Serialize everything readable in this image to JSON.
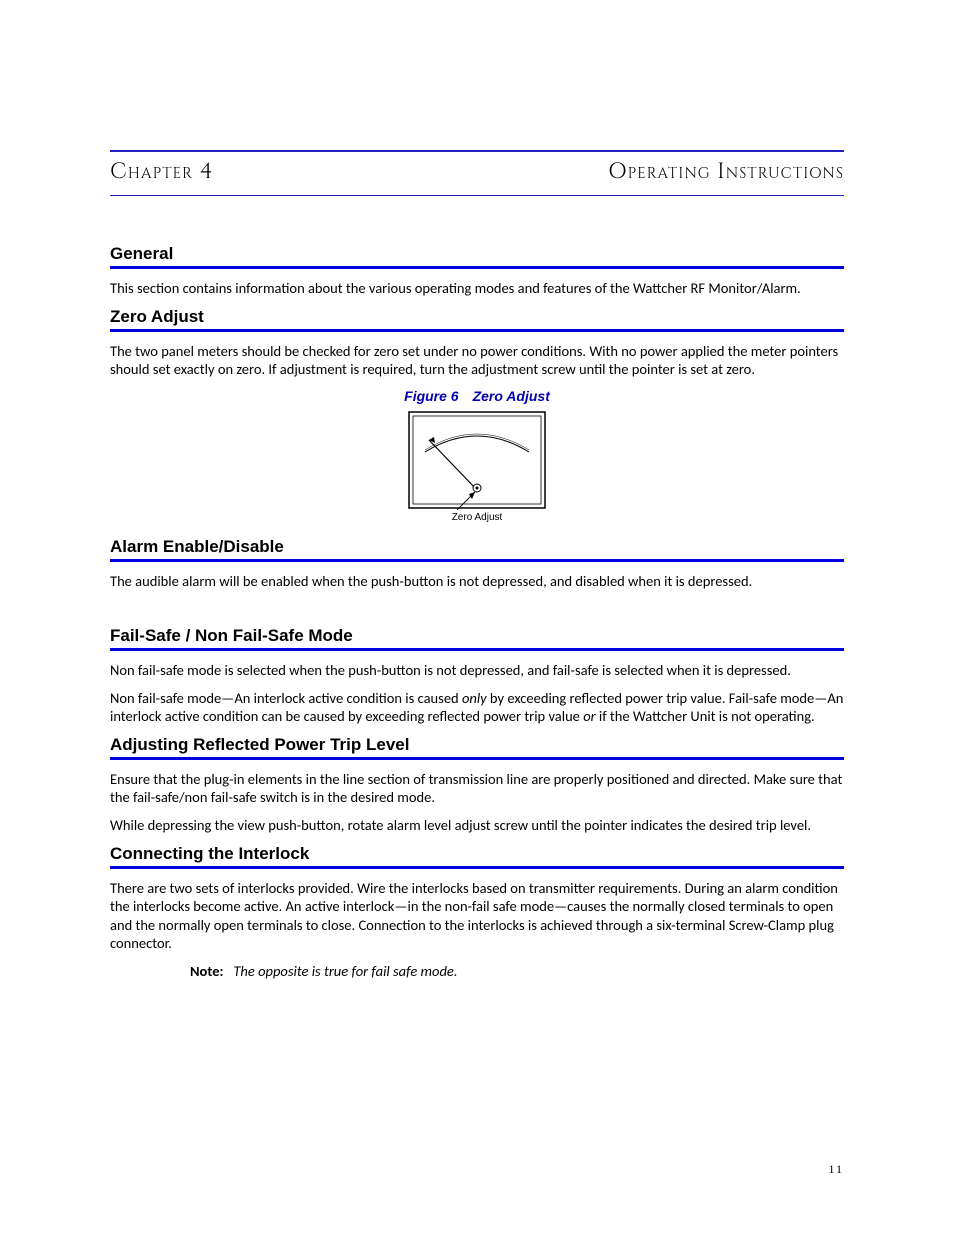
{
  "chapter": {
    "left": "Chapter 4",
    "right": "Operating Instructions"
  },
  "sections": {
    "general": {
      "heading": "General",
      "p1": "This section contains information about the various operating modes and features of the Wattcher RF Monitor/Alarm."
    },
    "zero_adjust": {
      "heading": "Zero Adjust",
      "p1": "The two panel meters should be checked for zero set under no power conditions. With no power applied the meter pointers should set exactly on zero. If adjustment is required, turn the adjustment screw until the pointer is set at zero.",
      "figure_caption": "Figure 6 Zero Adjust",
      "figure_label": "Zero Adjust"
    },
    "alarm": {
      "heading": "Alarm Enable/Disable",
      "p1": "The audible alarm will be enabled when the push-button is not depressed, and disabled when it is depressed."
    },
    "failsafe": {
      "heading": "Fail-Safe / Non Fail-Safe Mode",
      "p1": "Non fail-safe mode is selected when the push-button is not depressed, and fail-safe is selected when it is depressed.",
      "p2_a": "Non fail-safe mode—An interlock active condition is caused ",
      "p2_only": "only",
      "p2_b": " by exceeding reflected power trip value. Fail-safe mode—An interlock active condition can be caused by exceeding reflected power trip value ",
      "p2_or": "or",
      "p2_c": " if the Wattcher Unit is not operating."
    },
    "trip_level": {
      "heading": "Adjusting Reflected Power Trip Level",
      "p1": "Ensure that the plug-in elements in the line section of transmission line are properly positioned and directed. Make sure that the fail-safe/non fail-safe switch is in the desired mode.",
      "p2": "While depressing the view push-button, rotate alarm level adjust screw until the pointer indicates the desired trip level."
    },
    "interlock": {
      "heading": "Connecting the Interlock",
      "p1": "There are two sets of interlocks provided. Wire the interlocks based on transmitter requirements. During an alarm condition the interlocks become active. An active interlock—in the non-fail safe mode—causes the normally closed terminals to open and the normally open terminals to close. Connection to the interlocks is achieved through a six-terminal Screw-Clamp plug connector.",
      "note_label": "Note:",
      "note_text": "The opposite is true for fail safe mode."
    }
  },
  "page_number": "11"
}
